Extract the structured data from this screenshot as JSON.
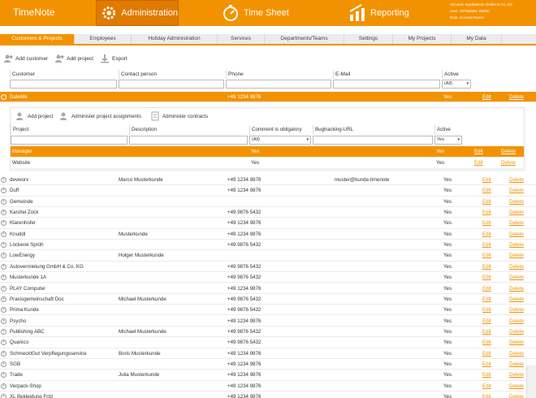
{
  "header": {
    "brand": "TimeNote",
    "nav": {
      "administration": "Administration",
      "time_sheet": "Time Sheet",
      "reporting": "Reporting"
    },
    "account": {
      "line1": "Account: Syndatecon GmbH & Co. KG",
      "line2": "User: Schmiedec Stefan",
      "line3": "Role: Account Owner"
    }
  },
  "tabs": [
    {
      "label": "Customers & Projects",
      "active": true
    },
    {
      "label": "Employees"
    },
    {
      "label": "Holiday Administration"
    },
    {
      "label": "Services"
    },
    {
      "label": "Departments/Teams"
    },
    {
      "label": "Settings"
    },
    {
      "label": "My Projects"
    },
    {
      "label": "My Data"
    }
  ],
  "toolbar": {
    "add_customer": "Add customer",
    "add_project": "Add project",
    "export": "Export"
  },
  "table": {
    "columns": {
      "customer": "Customer",
      "contact": "Contact person",
      "phone": "Phone",
      "email": "E-Mail",
      "active": "Active"
    },
    "active_filter": "(All)",
    "edit": "Edit",
    "delete": "Delete",
    "yes": "Yes",
    "selected_row": {
      "customer": "DateMe",
      "contact": "",
      "phone": "+49 1234 9876",
      "email": "",
      "active": "Yes"
    },
    "rows": [
      {
        "customer": "devworx",
        "contact": "Marco Musterkunde",
        "phone": "+49 1234 9876",
        "email": "muster@kunde.timenote",
        "active": "Yes"
      },
      {
        "customer": "Duff",
        "contact": "",
        "phone": "+49 1234 9876",
        "email": "",
        "active": "Yes"
      },
      {
        "customer": "Gemeinde",
        "contact": "",
        "phone": "",
        "email": "",
        "active": "Yes"
      },
      {
        "customer": "Kanzlei Zock",
        "contact": "",
        "phone": "+49 9876 5432",
        "email": "",
        "active": "Yes"
      },
      {
        "customer": "Klarenhofer",
        "contact": "",
        "phone": "+49 1234 9876",
        "email": "",
        "active": "Yes"
      },
      {
        "customer": "Knuddl",
        "contact": "Musterkunde",
        "phone": "+49 1234 9876",
        "email": "",
        "active": "Yes"
      },
      {
        "customer": "Löckerei Sprüh",
        "contact": "",
        "phone": "+49 9876 5432",
        "email": "",
        "active": "Yes"
      },
      {
        "customer": "LowEnergy",
        "contact": "Holger Musterkunde",
        "phone": "",
        "email": "",
        "active": "Yes"
      },
      {
        "customer": "Autovermietung GmbH & Co. KG",
        "contact": "",
        "phone": "+49 9876 5432",
        "email": "",
        "active": "Yes"
      },
      {
        "customer": "Musterkunde 1A",
        "contact": "",
        "phone": "+49 9876 5432",
        "email": "",
        "active": "Yes"
      },
      {
        "customer": "PLAY Computer",
        "contact": "",
        "phone": "+49 1234 9876",
        "email": "",
        "active": "Yes"
      },
      {
        "customer": "Praxisgemeinschaft Doc",
        "contact": "Michael Musterkunde",
        "phone": "+49 9876 5432",
        "email": "",
        "active": "Yes"
      },
      {
        "customer": "Prima Kunde",
        "contact": "",
        "phone": "+49 9876 5432",
        "email": "",
        "active": "Yes"
      },
      {
        "customer": "Psycho",
        "contact": "",
        "phone": "+49 1234 9876",
        "email": "",
        "active": "Yes"
      },
      {
        "customer": "Publishing ABC",
        "contact": "Michael Musterkunde",
        "phone": "+49 9876 5432",
        "email": "",
        "active": "Yes"
      },
      {
        "customer": "Quanico",
        "contact": "",
        "phone": "+49 9876 5432",
        "email": "",
        "active": "Yes"
      },
      {
        "customer": "SchmecktGut Verpflegungsservice",
        "contact": "Boris Musterkunde",
        "phone": "+49 1234 9876",
        "email": "",
        "active": "Yes"
      },
      {
        "customer": "SGB",
        "contact": "",
        "phone": "+49 1234 9876",
        "email": "",
        "active": "Yes"
      },
      {
        "customer": "Trade",
        "contact": "Julia Musterkunde",
        "phone": "+49 1234 9876",
        "email": "",
        "active": "Yes"
      },
      {
        "customer": "Verpack-Shop",
        "contact": "",
        "phone": "+49 1234 9876",
        "email": "",
        "active": "Yes"
      },
      {
        "customer": "XL Bekleidung Fritz",
        "contact": "",
        "phone": "+49 1234 9876",
        "email": "",
        "active": "Yes"
      }
    ]
  },
  "projects": {
    "toolbar": {
      "add_project": "Add project",
      "administer_assignments": "Administer project assignments",
      "administer_contracts": "Administer contracts"
    },
    "columns": {
      "project": "Project",
      "description": "Description",
      "comment": "Comment is obligatory",
      "bugtracking": "Bugtracking-URL",
      "active": "Active"
    },
    "comment_filter": "(All)",
    "active_filter": "Yes",
    "rows": [
      {
        "project": "Manager",
        "description": "",
        "comment": "Yes",
        "active": "Yes",
        "selected": true
      },
      {
        "project": "Website",
        "description": "",
        "comment": "Yes",
        "active": "Yes"
      }
    ]
  }
}
